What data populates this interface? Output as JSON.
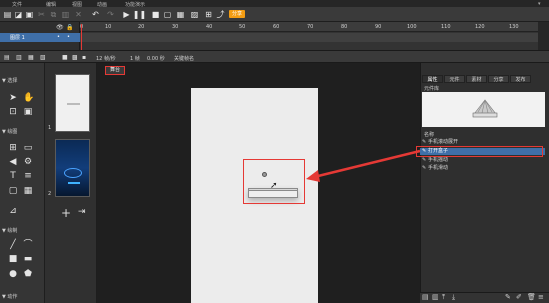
{
  "menubar": {
    "items": [
      "文件",
      "编辑",
      "视图",
      "动画",
      "功能演示"
    ]
  },
  "toolbar": {
    "share_label": "分享"
  },
  "timeline": {
    "ruler_labels": [
      "0",
      "10",
      "20",
      "30",
      "40",
      "50",
      "60",
      "70",
      "80",
      "90",
      "100",
      "110",
      "120",
      "130"
    ],
    "layer_name": "图层 1"
  },
  "tabbar": {
    "fps": "12 帧/秒",
    "frame": "1 帧",
    "time": "0.00 秒",
    "keyframe": "关键帧名"
  },
  "canvas": {
    "tab_label": "舞台"
  },
  "tool_sections": {
    "select": "▼ 选择",
    "draw": "▼ 绘图",
    "shape": "▼ 绘制",
    "more": "▼ 动作"
  },
  "pages": {
    "page1_num": "1",
    "page2_num": "2"
  },
  "right_panel": {
    "tabs": [
      "属性",
      "元件",
      "素材",
      "分享",
      "发布"
    ],
    "preview_label": "元件库",
    "list_header": "名称",
    "items": [
      "手机滚动展开",
      "打开盒子",
      "手机摇动",
      "手机滑动"
    ],
    "selected_index": 1
  },
  "colors": {
    "accent_red": "#e53935",
    "selection_blue": "#3f6fa8",
    "share_orange": "#f39c12"
  }
}
